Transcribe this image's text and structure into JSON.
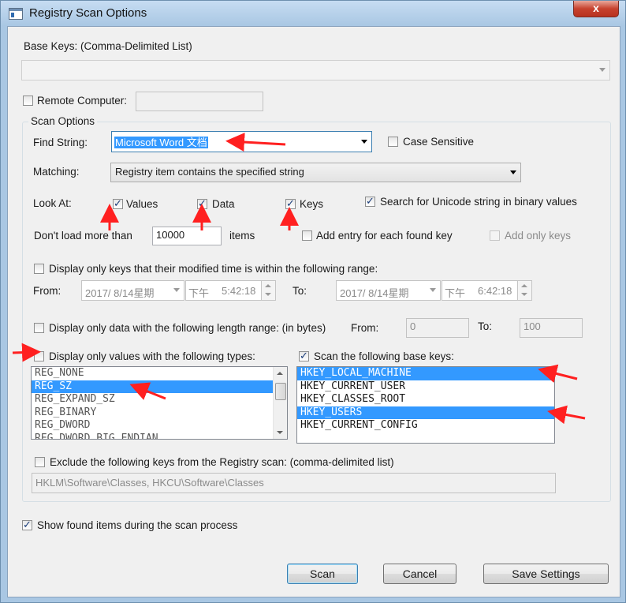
{
  "window": {
    "title": "Registry Scan Options",
    "close": "x"
  },
  "base_keys": {
    "label": "Base Keys:  (Comma-Delimited List)",
    "value": ""
  },
  "remote": {
    "label": "Remote Computer:",
    "checked": false,
    "value": ""
  },
  "scan_options": {
    "group_label": "Scan Options",
    "find_label": "Find String:",
    "find_value": "Microsoft Word 文档",
    "case_label": "Case Sensitive",
    "matching_label": "Matching:",
    "matching_value": "Registry item contains the specified string",
    "look_at_label": "Look At:",
    "values_label": "Values",
    "data_label": "Data",
    "keys_label": "Keys",
    "unicode_label": "Search for Unicode string in binary values",
    "dont_load_label": "Don't load more than",
    "dont_load_value": "10000",
    "items_label": "items",
    "add_entry_label": "Add entry for each found key",
    "add_only_keys_label": "Add only keys",
    "modified_label": "Display only keys that their modified time is within the following range:",
    "from_label": "From:",
    "to_label": "To:",
    "from_date": "2017/  8/14星期",
    "from_ampm": "下午",
    "from_time": "5:42:18",
    "to_date": "2017/  8/14星期",
    "to_ampm": "下午",
    "to_time": "6:42:18",
    "length_label": "Display only data with the following length range: (in bytes)",
    "length_from_label": "From:",
    "length_from_value": "0",
    "length_to_label": "To:",
    "length_to_value": "100",
    "types_label": "Display only values with the following types:",
    "types": [
      "REG_NONE",
      "REG_SZ",
      "REG_EXPAND_SZ",
      "REG_BINARY",
      "REG_DWORD",
      "REG_DWORD_BIG_ENDIAN"
    ],
    "base_keys_label": "Scan the following base keys:",
    "base_keys_list": [
      "HKEY_LOCAL_MACHINE",
      "HKEY_CURRENT_USER",
      "HKEY_CLASSES_ROOT",
      "HKEY_USERS",
      "HKEY_CURRENT_CONFIG"
    ],
    "exclude_label": "Exclude the following keys from the Registry scan: (comma-delimited list)",
    "exclude_value": "HKLM\\Software\\Classes, HKCU\\Software\\Classes"
  },
  "show_found_label": "Show found items during the scan process",
  "buttons": {
    "scan": "Scan",
    "cancel": "Cancel",
    "save": "Save Settings"
  },
  "accent": "#3399ff",
  "annotation_color": "#ff2020"
}
